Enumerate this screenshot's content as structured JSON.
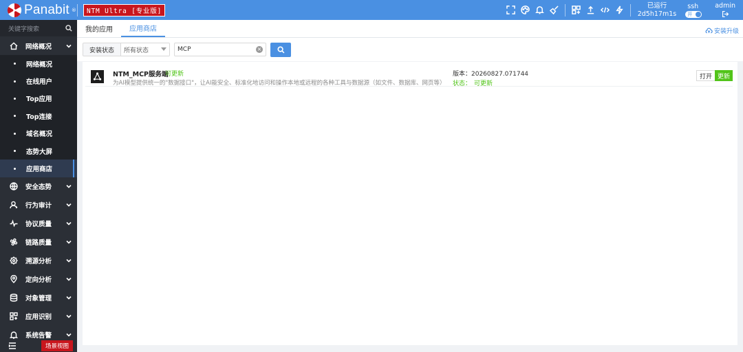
{
  "header": {
    "brand": "Panabit",
    "edition": "NTM Ultra [专业版]",
    "uptime_label": "已运行",
    "uptime_value": "2d5h17m1s",
    "ssh_label": "ssh",
    "ssh_toggle": "开",
    "user": "admin",
    "icons": [
      "fullscreen-icon",
      "palette-icon",
      "bell-icon",
      "broom-icon",
      "layout-icon",
      "upload-icon",
      "code-icon",
      "lightning-icon",
      "logout-icon"
    ],
    "accent": "#4a90e2",
    "brand_red": "#c8161d"
  },
  "sidebar": {
    "search_placeholder": "关键字搜索",
    "groups": [
      {
        "label": "网络概况",
        "icon": "home-icon",
        "expanded": true
      },
      {
        "label": "安全态势",
        "icon": "globe-icon"
      },
      {
        "label": "行为审计",
        "icon": "user-icon"
      },
      {
        "label": "协议质量",
        "icon": "pulse-icon"
      },
      {
        "label": "链路质量",
        "icon": "fan-icon"
      },
      {
        "label": "溯源分析",
        "icon": "badge-icon"
      },
      {
        "label": "定向分析",
        "icon": "location-icon"
      },
      {
        "label": "对象管理",
        "icon": "database-icon"
      },
      {
        "label": "应用识别",
        "icon": "apps-icon"
      },
      {
        "label": "系统告警",
        "icon": "alarm-icon"
      }
    ],
    "sub_items": [
      "网络概况",
      "在线用户",
      "Top应用",
      "Top连接",
      "域名概况",
      "态势大屏",
      "应用商店"
    ],
    "active_sub": "应用商店",
    "scene_button": "场景视图"
  },
  "tabs": [
    "我的应用",
    "应用商店"
  ],
  "active_tab": "应用商店",
  "install_upgrade": "安装升级",
  "filter": {
    "status_label": "安装状态",
    "status_value": "所有状态",
    "query": "MCP"
  },
  "app": {
    "name": "NTM_MCP服务端",
    "badge": "可更新",
    "description": "为AI模型提供统一的\"数据接口\"，让AI能安全、标准化地访问和操作本地或远程的各种工具与数据源（如文件、数据库、网页等）",
    "version": "版本：20260827.071744",
    "status_label": "状态：",
    "status_value": "可更新",
    "open_button": "打开",
    "update_button": "更新",
    "status_color": "#52c41a"
  }
}
